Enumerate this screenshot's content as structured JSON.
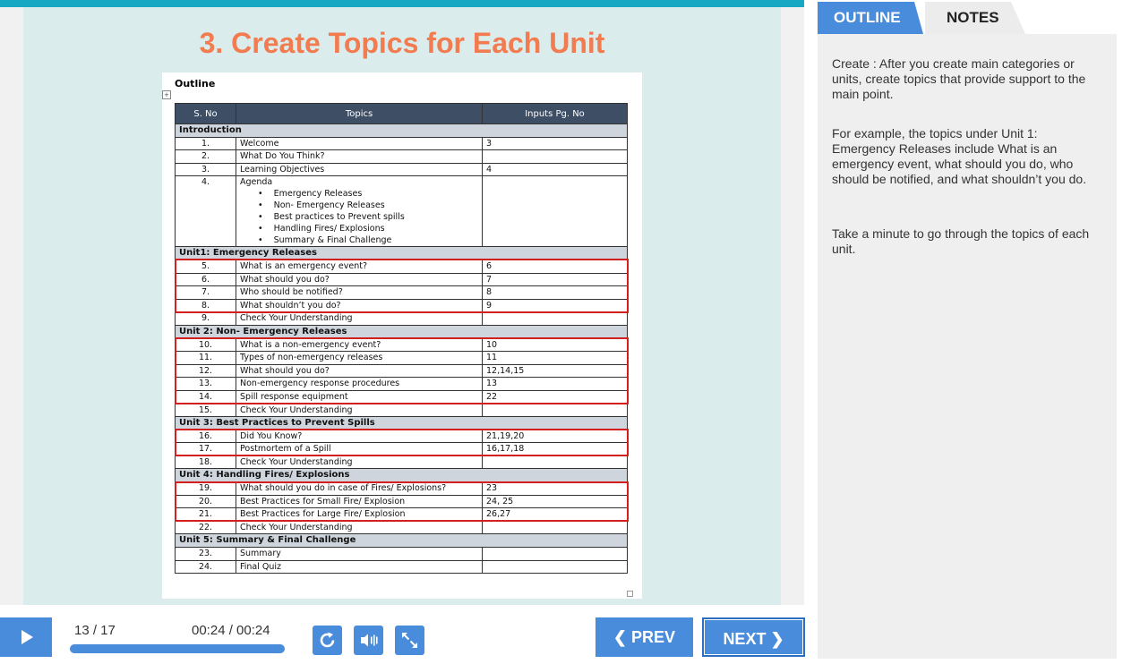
{
  "slide": {
    "title": "3. Create Topics for Each Unit"
  },
  "document": {
    "outline_label": "Outline",
    "headers": [
      "S. No",
      "Topics",
      "Inputs Pg. No"
    ],
    "rows": [
      {
        "type": "section",
        "label": "Introduction"
      },
      {
        "type": "row",
        "num": "1.",
        "topic": "Welcome",
        "pages": "3"
      },
      {
        "type": "row",
        "num": "2.",
        "topic": "What Do You Think?",
        "pages": ""
      },
      {
        "type": "row",
        "num": "3.",
        "topic": "Learning Objectives",
        "pages": "4"
      },
      {
        "type": "agenda",
        "num": "4.",
        "topic": "Agenda",
        "items": [
          "Emergency Releases",
          "Non- Emergency Releases",
          "Best practices to Prevent spills",
          "Handling Fires/ Explosions",
          "Summary & Final Challenge"
        ],
        "pages": ""
      },
      {
        "type": "section",
        "label": "Unit1: Emergency Releases"
      },
      {
        "type": "row",
        "num": "5.",
        "topic": "What is an emergency event?",
        "pages": "6"
      },
      {
        "type": "row",
        "num": "6.",
        "topic": "What should you do?",
        "pages": "7"
      },
      {
        "type": "row",
        "num": "7.",
        "topic": "Who should be notified?",
        "pages": "8"
      },
      {
        "type": "row",
        "num": "8.",
        "topic": "What shouldn’t you do?",
        "pages": "9"
      },
      {
        "type": "row",
        "num": "9.",
        "topic": "Check Your Understanding",
        "pages": ""
      },
      {
        "type": "section",
        "label": "Unit 2: Non- Emergency Releases"
      },
      {
        "type": "row",
        "num": "10.",
        "topic": "What is a non-emergency event?",
        "pages": "10"
      },
      {
        "type": "row",
        "num": "11.",
        "topic": "Types of non-emergency releases",
        "pages": "11"
      },
      {
        "type": "row",
        "num": "12.",
        "topic": "What should you do?",
        "pages": "12,14,15"
      },
      {
        "type": "row",
        "num": "13.",
        "topic": "Non-emergency response procedures",
        "pages": "13"
      },
      {
        "type": "row",
        "num": "14.",
        "topic": "Spill response equipment",
        "pages": "22"
      },
      {
        "type": "row",
        "num": "15.",
        "topic": "Check Your Understanding",
        "pages": ""
      },
      {
        "type": "section",
        "label": "Unit 3: Best Practices to Prevent Spills"
      },
      {
        "type": "row",
        "num": "16.",
        "topic": "Did You Know?",
        "pages": "21,19,20"
      },
      {
        "type": "row",
        "num": "17.",
        "topic": "Postmortem of a Spill",
        "pages": "16,17,18"
      },
      {
        "type": "row",
        "num": "18.",
        "topic": "Check Your Understanding",
        "pages": ""
      },
      {
        "type": "section",
        "label": "Unit 4: Handling Fires/ Explosions"
      },
      {
        "type": "row",
        "num": "19.",
        "topic": "What should you do in case of Fires/ Explosions?",
        "pages": "23"
      },
      {
        "type": "row",
        "num": "20.",
        "topic": "Best Practices for Small Fire/ Explosion",
        "pages": "24, 25"
      },
      {
        "type": "row",
        "num": "21.",
        "topic": "Best Practices for Large Fire/ Explosion",
        "pages": "26,27"
      },
      {
        "type": "row",
        "num": "22.",
        "topic": "Check Your Understanding",
        "pages": ""
      },
      {
        "type": "section",
        "label": "Unit 5: Summary & Final Challenge"
      },
      {
        "type": "row",
        "num": "23.",
        "topic": "Summary",
        "pages": ""
      },
      {
        "type": "row",
        "num": "24.",
        "topic": "Final Quiz",
        "pages": ""
      }
    ]
  },
  "sidebar": {
    "tab_outline": "OUTLINE",
    "tab_notes": "NOTES",
    "notes": [
      "Create : After you create main categories or units, create topics that provide support to the main point.",
      "For example, the topics under Unit 1: Emergency Releases include What is an emergency event, what should you do, who should be notified, and what shouldn’t you do.",
      "Take a minute to go through the topics of each unit."
    ]
  },
  "controls": {
    "page_count": "13 / 17",
    "time": "00:24 / 00:24",
    "progress": 1.0,
    "prev_label": "PREV",
    "next_label": "NEXT"
  },
  "colors": {
    "accent": "#4a8cdc",
    "title": "#f27b50",
    "highlight": "#d41f1f"
  },
  "icons": {
    "play": "play-icon",
    "replay": "replay-icon",
    "volume": "volume-icon",
    "fullscreen": "fullscreen-icon"
  }
}
